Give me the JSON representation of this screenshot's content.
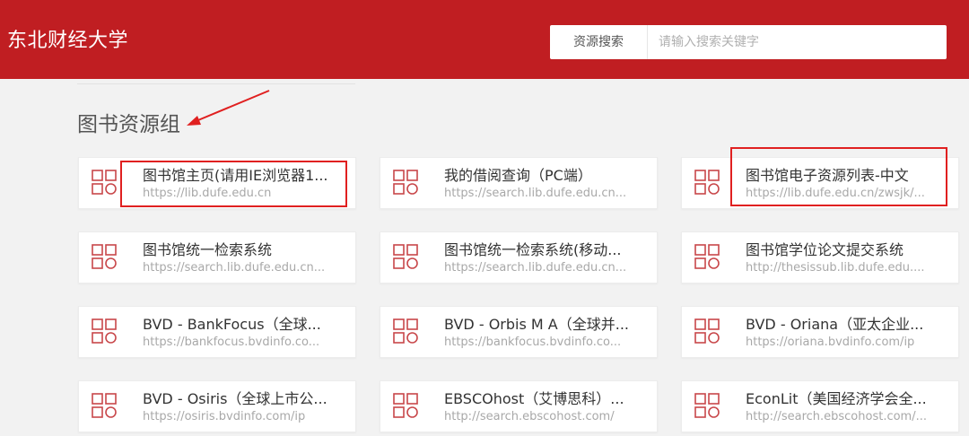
{
  "header": {
    "title": "东北财经大学",
    "search_category": "资源搜索",
    "search_placeholder": "请输入搜索关键字",
    "background_color": "#c01e22"
  },
  "section": {
    "title": "图书资源组"
  },
  "icon_name": "app-grid-icon",
  "accent_color": "#c01e22",
  "highlight_color": "#e02020",
  "cards": [
    {
      "title": "图书馆主页(请用IE浏览器1...",
      "url": "https://lib.dufe.edu.cn"
    },
    {
      "title": "我的借阅查询（PC端）",
      "url": "https://search.lib.dufe.edu.cn..."
    },
    {
      "title": "图书馆电子资源列表-中文",
      "url": "https://lib.dufe.edu.cn/zwsjk/..."
    },
    {
      "title": "图书馆统一检索系统",
      "url": "https://search.lib.dufe.edu.cn..."
    },
    {
      "title": "图书馆统一检索系统(移动...",
      "url": "https://search.lib.dufe.edu.cn..."
    },
    {
      "title": "图书馆学位论文提交系统",
      "url": "http://thesissub.lib.dufe.edu...."
    },
    {
      "title": "BVD - BankFocus（全球...",
      "url": "https://bankfocus.bvdinfo.co..."
    },
    {
      "title": "BVD - Orbis M A（全球并...",
      "url": "https://bankfocus.bvdinfo.co..."
    },
    {
      "title": "BVD - Oriana（亚太企业...",
      "url": "https://oriana.bvdinfo.com/ip"
    },
    {
      "title": "BVD - Osiris（全球上市公...",
      "url": "https://osiris.bvdinfo.com/ip"
    },
    {
      "title": "EBSCOhost（艾博思科）...",
      "url": "http://search.ebscohost.com/"
    },
    {
      "title": "EconLit（美国经济学会全...",
      "url": "http://search.ebscohost.com/..."
    }
  ]
}
